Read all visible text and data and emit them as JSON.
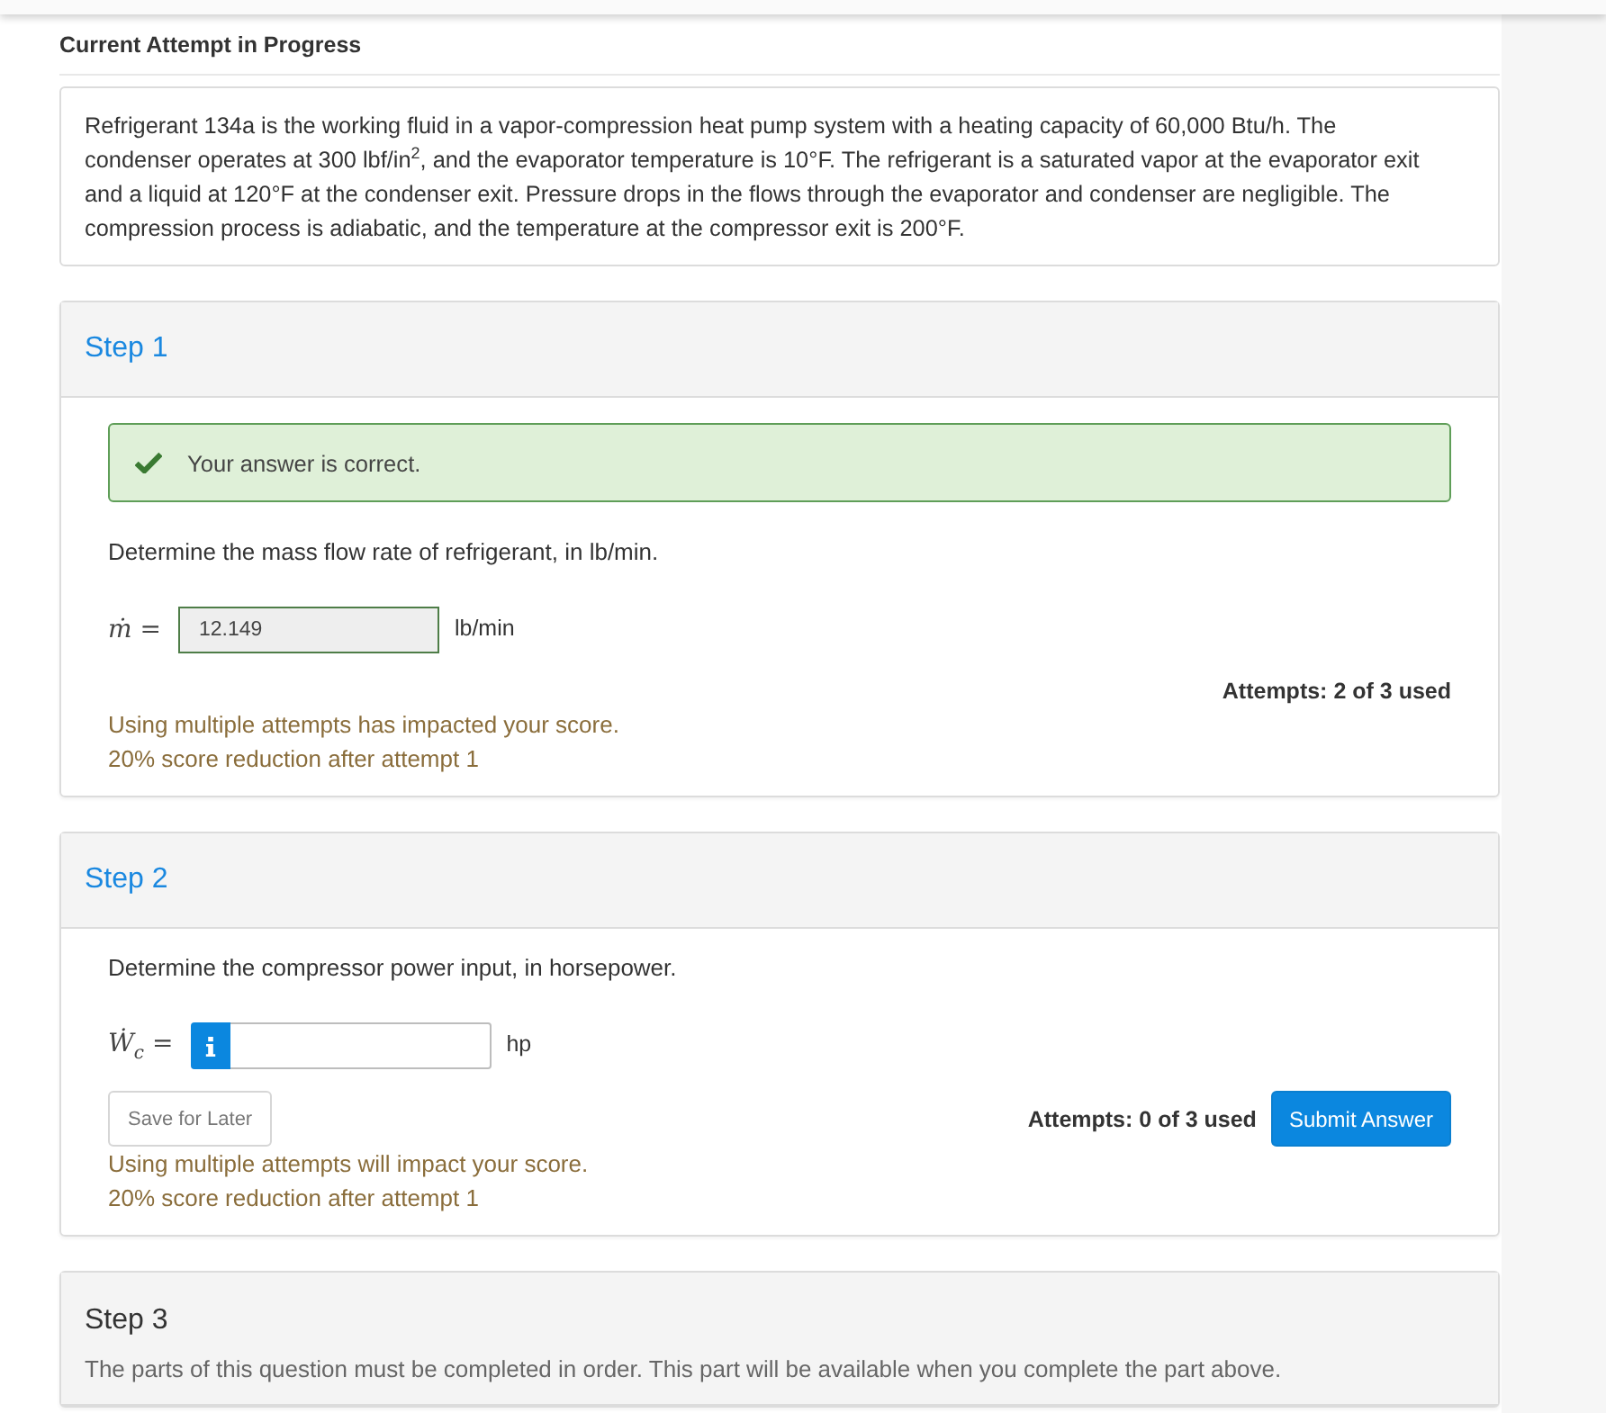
{
  "heading": "Current Attempt in Progress",
  "question": "Refrigerant 134a is the working fluid in a vapor-compression heat pump system with a heating capacity of 60,000 Btu/h. The condenser operates at 300 lbf/in$^{2}$, and the evaporator temperature is 10°F. The refrigerant is a saturated vapor at the evaporator exit and a liquid at 120°F at the condenser exit. Pressure drops in the flows through the evaporator and condenser are negligible. The compression process is adiabatic, and the temperature at the compressor exit is 200°F.",
  "steps": [
    {
      "title": "Step 1",
      "locked": false,
      "feedback": {
        "kind": "correct",
        "text": "Your answer is correct."
      },
      "prompt": "Determine the mass flow rate of refrigerant, in lb/min.",
      "answer": {
        "label": "*ṁ* =",
        "info_button": false,
        "value": "12.149",
        "correct": true,
        "unit": "lb/min"
      },
      "attempts": "Attempts: 2 of 3 used",
      "score_notes": [
        "Using multiple attempts has impacted your score.",
        "20% score reduction after attempt 1"
      ]
    },
    {
      "title": "Step 2",
      "locked": false,
      "prompt": "Determine the compressor power input, in horsepower.",
      "answer": {
        "label": "*Ẇ*$_{c}$ =",
        "info_button": true,
        "correct": false,
        "unit": "hp"
      },
      "save_button": "Save for Later",
      "attempts": "Attempts: 0 of 3 used",
      "submit_button": "Submit Answer",
      "score_notes": [
        "Using multiple attempts will impact your score.",
        "20% score reduction after attempt 1"
      ]
    },
    {
      "title": "Step 3",
      "locked": true,
      "message": "The parts of this question must be completed in order. This part will be available when you complete the part above."
    }
  ]
}
